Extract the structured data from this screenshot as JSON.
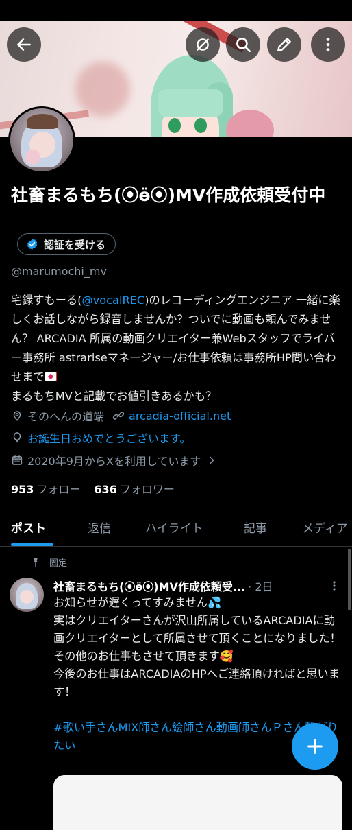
{
  "colors": {
    "background": "#000000",
    "accent": "#1d9bf0",
    "text_primary": "#e7e9ea",
    "text_secondary": "#8b98a5"
  },
  "header": {
    "icons": {
      "back": "arrow-left-icon",
      "translate": "no-translate-icon",
      "search": "search-icon",
      "edit": "pencil-icon",
      "more": "more-vertical-icon"
    }
  },
  "profile": {
    "display_name": "社畜まるもち(⦿ӫ⦿)MV作成依頼受付中",
    "verify_button_label": "認証を受ける",
    "handle": "@marumochi_mv",
    "bio": {
      "text_before_mention": "宅録すもーる(",
      "mention": "@vocalREC",
      "text_after_mention": ")のレコーディングエンジニア 一緒に楽しくお話しながら録音しませんか？ついでに動画も頼んでみません？ ARCADIA 所属の動画クリエイター兼Webスタッフでライバー事務所 astrariseマネージャー/お仕事依頼は事務所HP問い合わせまで",
      "text_after_emoji": "\nまるもちMVと記載でお値引きあるかも？"
    },
    "location": "そのへんの道端",
    "website": "arcadia-official.net",
    "birthday_text": "お誕生日おめでとうございます。",
    "joined": "2020年9月からXを利用しています",
    "following_count": "953",
    "following_label": "フォロー",
    "followers_count": "636",
    "followers_label": "フォロワー"
  },
  "tabs": [
    {
      "label": "ポスト",
      "active": true
    },
    {
      "label": "返信",
      "active": false
    },
    {
      "label": "ハイライト",
      "active": false
    },
    {
      "label": "記事",
      "active": false
    },
    {
      "label": "メディア",
      "active": false
    }
  ],
  "pinned_post": {
    "pinned_label": "固定",
    "author_name": "社畜まるもち(⦿ӫ⦿)MV作成依頼受...",
    "time": "· 2日",
    "line1": "お知らせが遅くってすみません💦",
    "line2": "実はクリエイターさんが沢山所属しているARCADIAに動画クリエイターとして所属させて頂くことになりました！その他のお仕事もさせて頂きます🥰",
    "line3": "今後のお仕事はARCADIAのHPへご連絡頂ければと思います！",
    "hashtags": "#歌い手さんMIX師さん絵師さん動画師さんＰさん繋がりたい"
  },
  "fab": {
    "icon": "plus-icon"
  }
}
